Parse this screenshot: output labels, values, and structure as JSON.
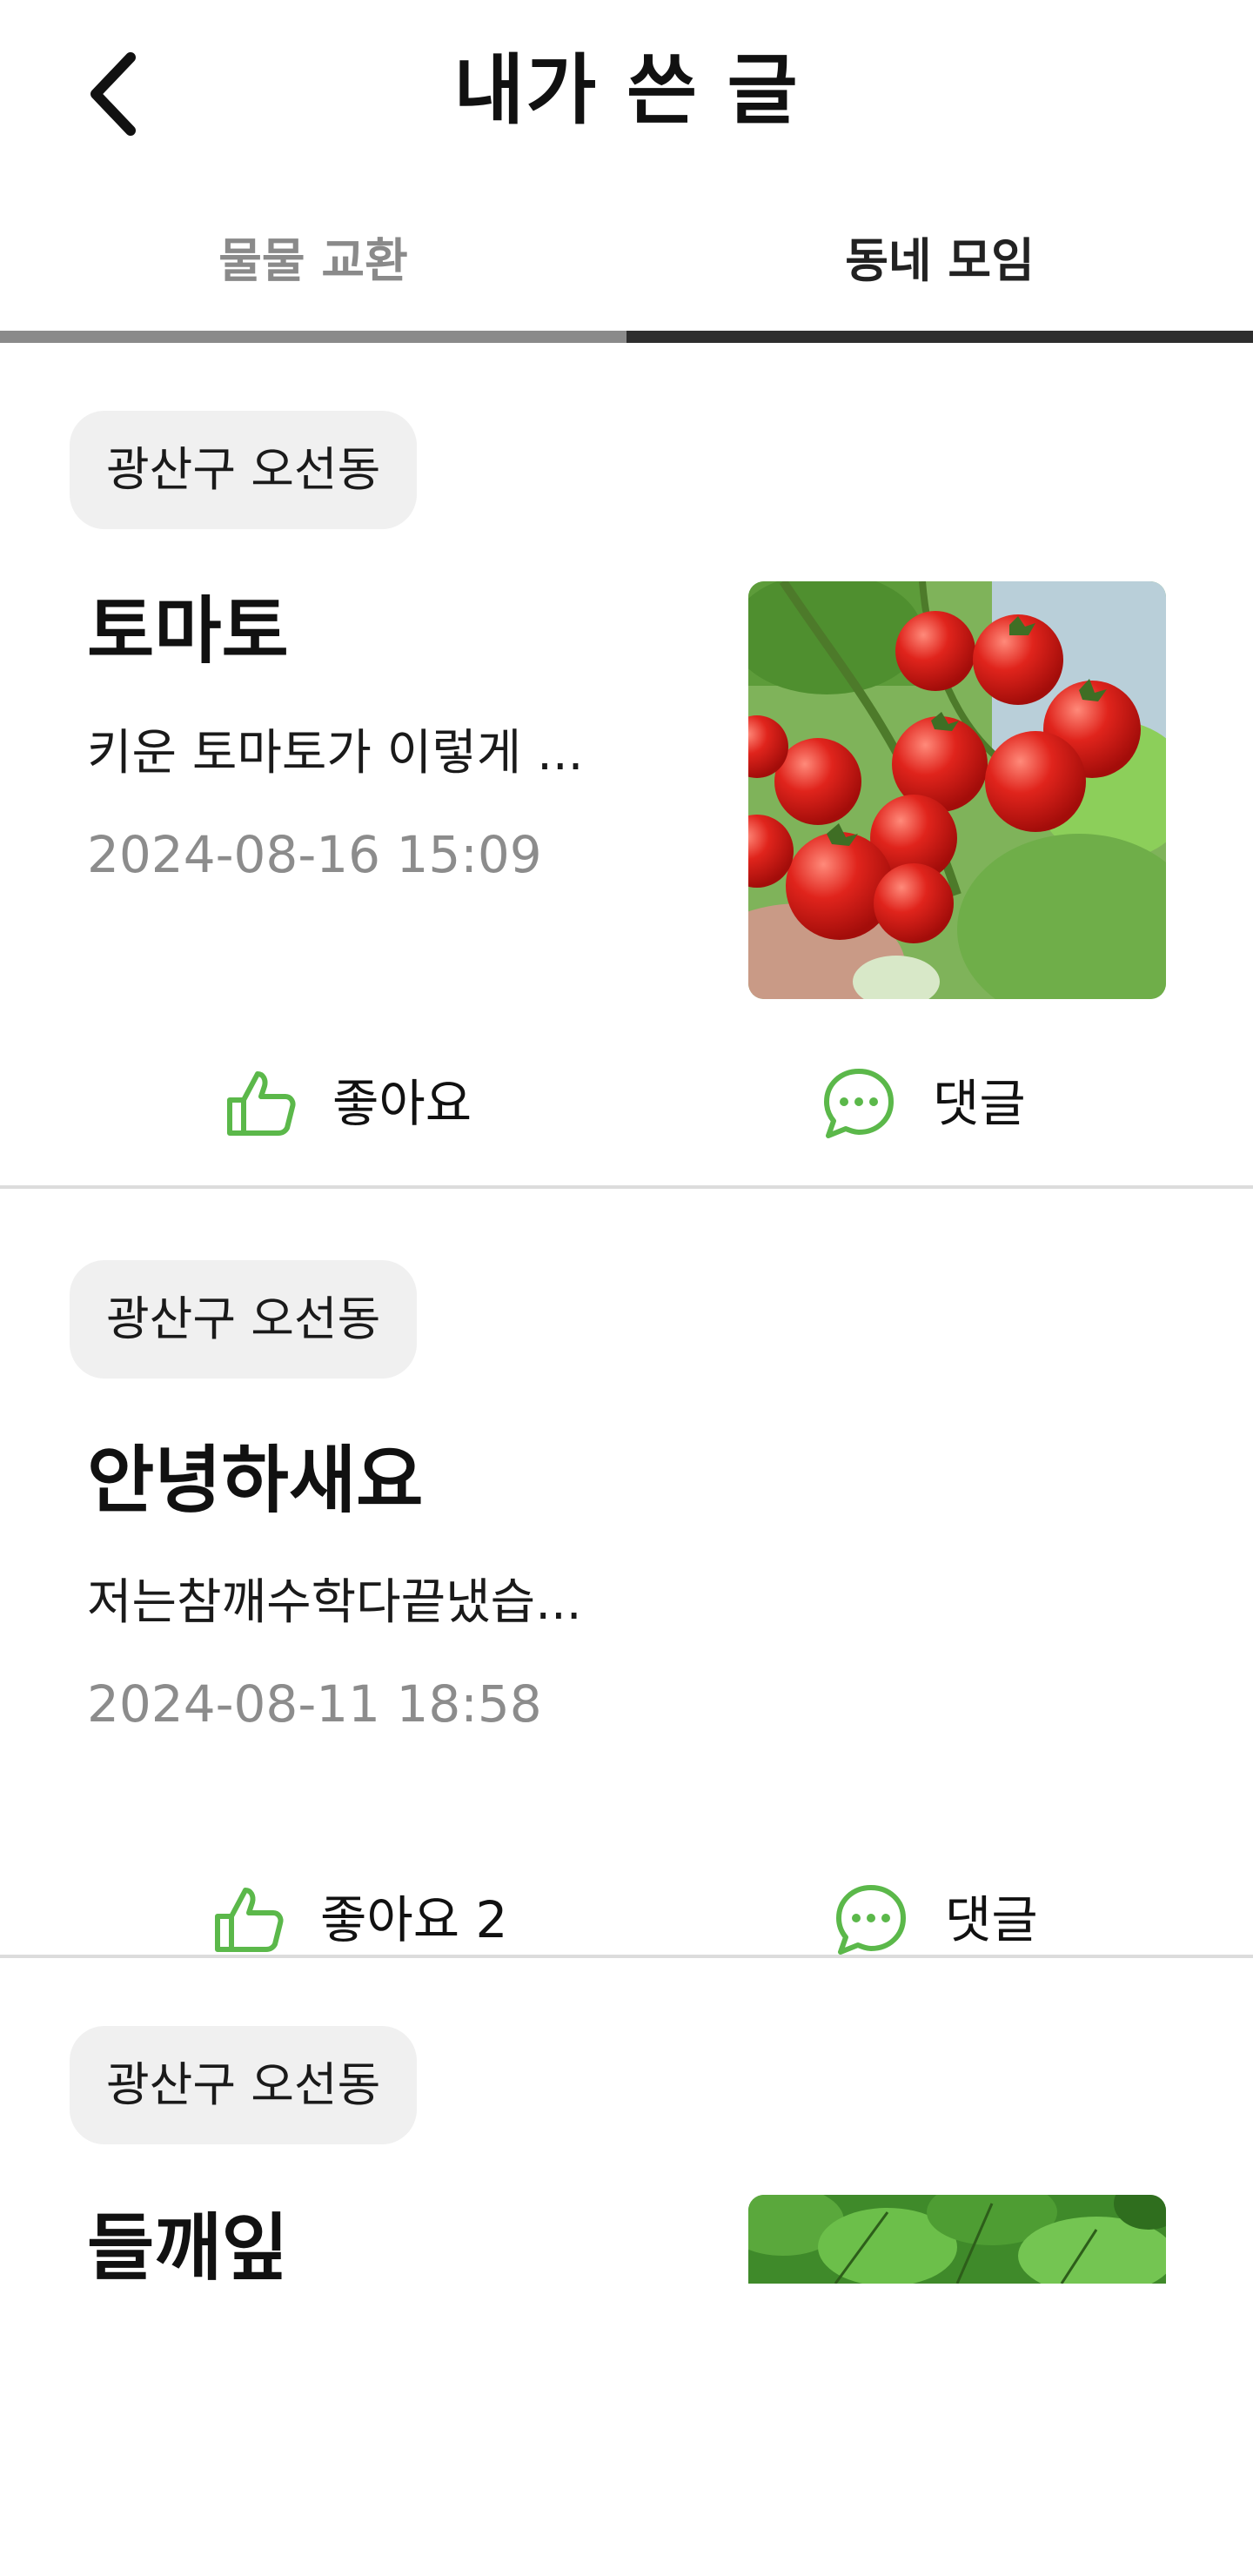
{
  "header": {
    "title": "내가 쓴 글",
    "back_icon": "chevron-left-icon"
  },
  "tabs": [
    {
      "label": "물물 교환",
      "selected": false
    },
    {
      "label": "동네 모임",
      "selected": true
    }
  ],
  "posts": [
    {
      "location": "광산구 오선동",
      "title": "토마토",
      "body": "키운 토마토가 이렇게 ...",
      "date": "2024-08-16 15:09",
      "has_image": true,
      "image_subject": "cherry tomatoes on vine",
      "like_label": "좋아요",
      "comment_label": "댓글"
    },
    {
      "location": "광산구 오선동",
      "title": "안녕하새요",
      "body": "저는참깨수학다끝냈습...",
      "date": "2024-08-11 18:58",
      "has_image": false,
      "like_label": "좋아요 2",
      "comment_label": "댓글"
    },
    {
      "location": "광산구 오선동",
      "title": "들깨잎",
      "has_image": true,
      "image_subject": "perilla leaves"
    }
  ],
  "colors": {
    "accent_green": "#5bb84a",
    "tab_selected": "#2d2d2d",
    "tab_unselected": "#8a8a8a",
    "chip_bg": "#f0f0f0",
    "date_gray": "#8c8c8c"
  }
}
